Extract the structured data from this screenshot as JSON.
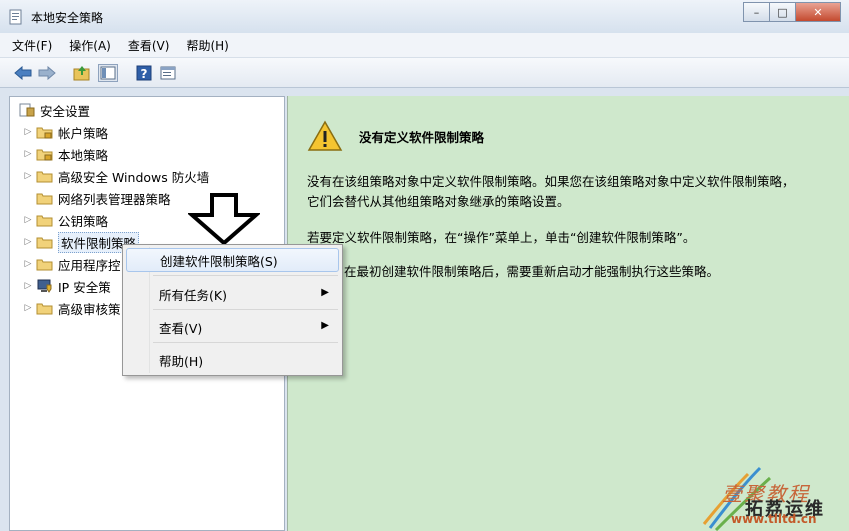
{
  "window": {
    "title": "本地安全策略",
    "buttons": [
      "–",
      "□",
      "✕"
    ]
  },
  "menubar": {
    "items": [
      "文件(F)",
      "操作(A)",
      "查看(V)",
      "帮助(H)"
    ]
  },
  "toolbar": {
    "icons": [
      "back-arrow-icon",
      "forward-arrow-icon",
      "up-folder-icon",
      "show-hide-tree-icon",
      "help-icon",
      "properties-icon"
    ]
  },
  "tree": {
    "root": "安全设置",
    "items": [
      {
        "label": "帐户策略",
        "icon": "folder-lock-icon",
        "expandable": true
      },
      {
        "label": "本地策略",
        "icon": "folder-lock-icon",
        "expandable": true
      },
      {
        "label": "高级安全 Windows 防火墙",
        "icon": "folder-icon",
        "expandable": true
      },
      {
        "label": "网络列表管理器策略",
        "icon": "folder-icon",
        "expandable": false
      },
      {
        "label": "公钥策略",
        "icon": "folder-icon",
        "expandable": true
      },
      {
        "label": "软件限制策略",
        "icon": "folder-icon",
        "expandable": true,
        "selected": true
      },
      {
        "label": "应用程序控",
        "icon": "folder-icon",
        "expandable": true
      },
      {
        "label": "IP 安全策",
        "icon": "computer-shield-icon",
        "expandable": true
      },
      {
        "label": "高级审核策",
        "icon": "folder-icon",
        "expandable": true
      }
    ]
  },
  "context_menu": {
    "items": [
      {
        "label": "创建软件限制策略(S)",
        "submenu": false,
        "highlighted": true
      },
      {
        "label": "所有任务(K)",
        "submenu": true
      },
      {
        "label": "查看(V)",
        "submenu": true
      },
      {
        "label": "帮助(H)",
        "submenu": false
      }
    ]
  },
  "details": {
    "heading": "没有定义软件限制策略",
    "p1_line1": "没有在该组策略对象中定义软件限制策略。如果您在该组策略对象中定义软件限制策略，",
    "p1_line2": "它们会替代从其他组策略对象继承的策略设置。",
    "p2": "若要定义软件限制策略，在“操作”菜单上，单击“创建软件限制策略”。",
    "p3_visible": "在最初创建软件限制策略后，需要重新启动才能强制执行这些策略。"
  },
  "watermark": {
    "line1": "壹聚教程",
    "line2": "拓荔运维",
    "url": "www.tlltd.cn"
  }
}
